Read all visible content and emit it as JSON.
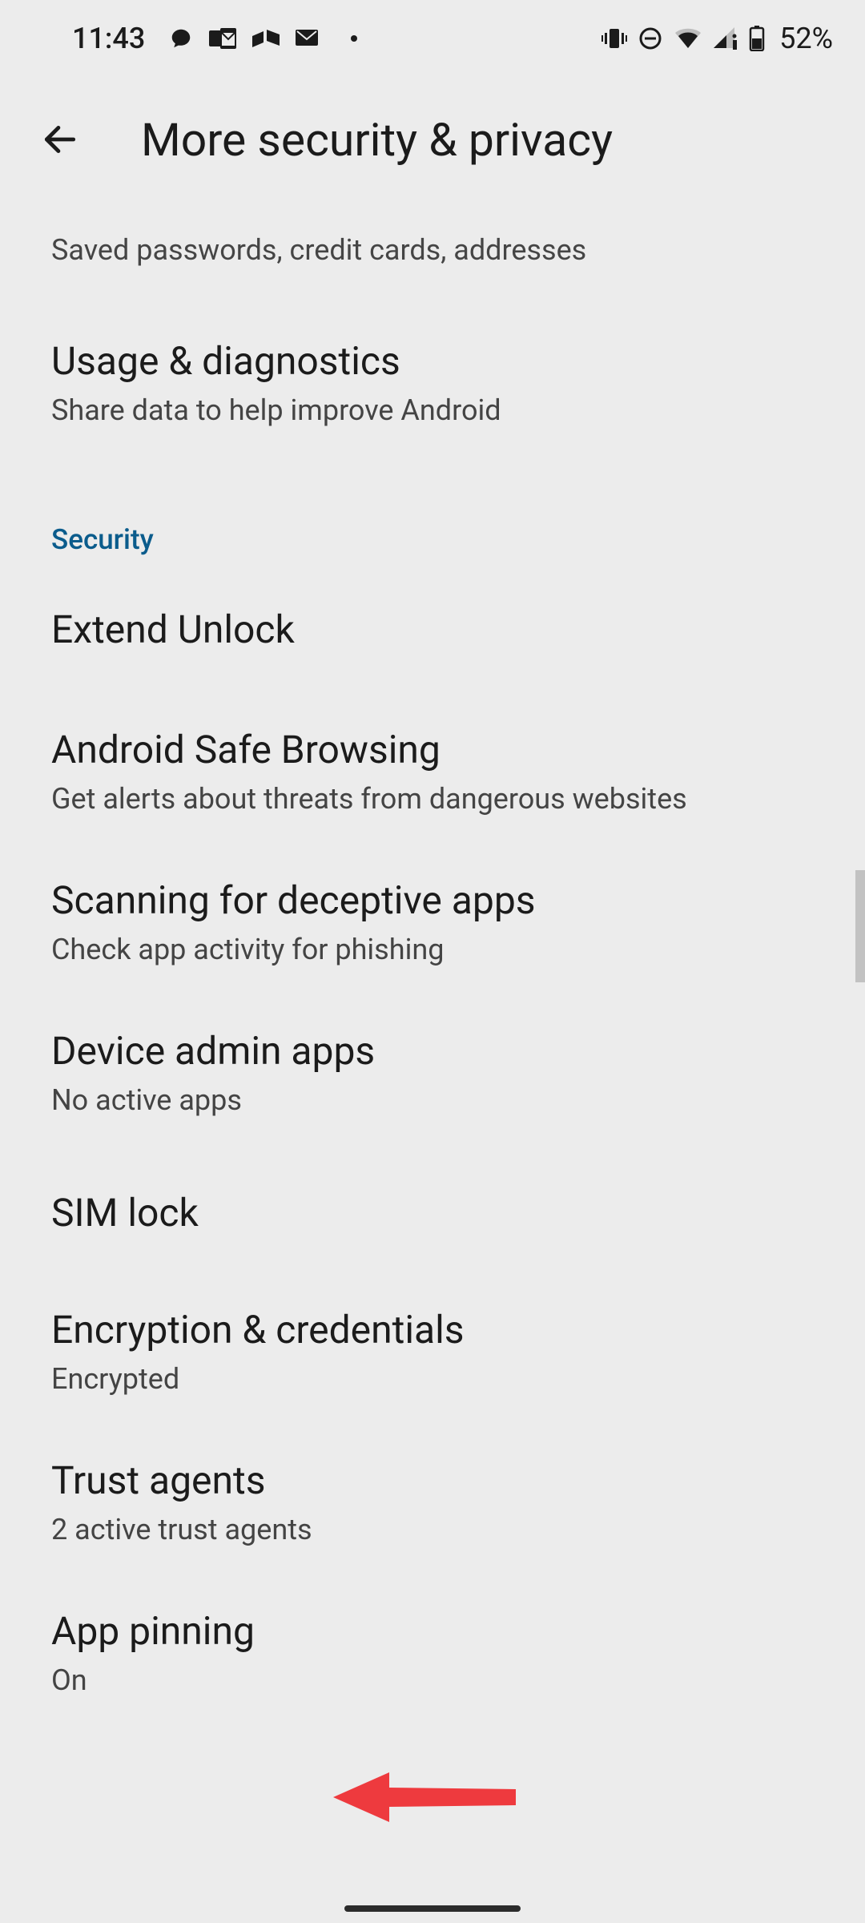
{
  "statusbar": {
    "time": "11:43",
    "battery_text": "52%",
    "icons_left": [
      "chat-icon",
      "outlook-icon",
      "files-icon",
      "mail-attach-icon",
      "dot-icon"
    ],
    "icons_right": [
      "vibrate-icon",
      "dnd-icon",
      "wifi-icon",
      "signal-icon",
      "battery-icon"
    ]
  },
  "appbar": {
    "title": "More security & privacy"
  },
  "partial_item": {
    "sub": "Saved passwords, credit cards, addresses"
  },
  "items_top": [
    {
      "title": "Usage & diagnostics",
      "sub": "Share data to help improve Android"
    }
  ],
  "section": {
    "label": "Security"
  },
  "items_security": [
    {
      "title": "Extend Unlock",
      "sub": ""
    },
    {
      "title": "Android Safe Browsing",
      "sub": "Get alerts about threats from dangerous websites"
    },
    {
      "title": "Scanning for deceptive apps",
      "sub": "Check app activity for phishing"
    },
    {
      "title": "Device admin apps",
      "sub": "No active apps"
    },
    {
      "title": "SIM lock",
      "sub": ""
    },
    {
      "title": "Encryption & credentials",
      "sub": "Encrypted"
    },
    {
      "title": "Trust agents",
      "sub": "2 active trust agents"
    },
    {
      "title": "App pinning",
      "sub": "On"
    }
  ],
  "annotation": {
    "target_label": "App pinning",
    "color": "#ee3a3e"
  }
}
